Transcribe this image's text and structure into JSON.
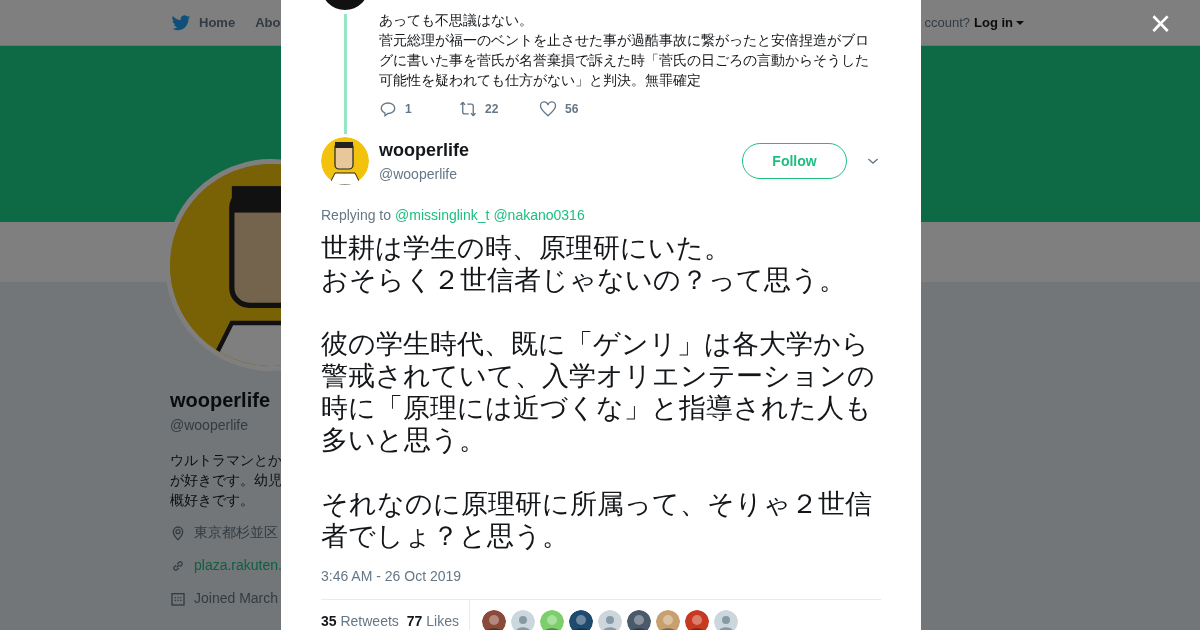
{
  "nav": {
    "items": [
      {
        "label": "Home"
      },
      {
        "label": "Abo"
      }
    ],
    "account_prompt": "ccount?",
    "login": "Log in"
  },
  "profile": {
    "name": "wooperlife",
    "handle": "@wooperlife",
    "bio_lines": [
      "ウルトラマンとか",
      "が好きです。幼児",
      "概好きです。"
    ],
    "location": "東京都杉並区",
    "url": "plaza.rakuten.",
    "joined": "Joined March"
  },
  "modal": {
    "close": "×",
    "previous_tweet": {
      "lines": [
        "あっても不思議はない。",
        "菅元総理が福一のベントを止させた事が過酷事故に繋がったと安倍捏造がブロ",
        "グに書いた事を菅氏が名誉棄損で訴えた時「菅氏の日ごろの言動からそうした",
        "可能性を疑われても仕方がない」と判決。無罪確定"
      ],
      "actions": [
        {
          "kind": "reply",
          "count": "1"
        },
        {
          "kind": "retweet",
          "count": "22"
        },
        {
          "kind": "like",
          "count": "56"
        }
      ]
    },
    "tweet": {
      "name": "wooperlife",
      "handle": "@wooperlife",
      "follow": "Follow",
      "replying_label": "Replying to",
      "mentions": [
        "@missinglink_t",
        "@nakano0316"
      ],
      "paragraphs": [
        [
          "世耕は学生の時、原理研にいた。",
          "おそらく２世信者じゃないの？って思う。"
        ],
        [
          "彼の学生時代、既に「ゲンリ」は各大学から",
          "警戒されていて、入学オリエンテーションの",
          "時に「原理には近づくな」と指導された人も",
          "多いと思う。"
        ],
        [
          "それなのに原理研に所属って、そりゃ２世信",
          "者でしょ？と思う。"
        ]
      ],
      "timestamp": "3:46 AM - 26 Oct 2019",
      "stats": [
        {
          "count": "35",
          "label": "Retweets"
        },
        {
          "count": "77",
          "label": "Likes"
        }
      ],
      "likers": [
        {
          "kind": "picture",
          "color": "#8a4a3a"
        },
        {
          "kind": "default"
        },
        {
          "kind": "picture",
          "color": "#7ccf6a"
        },
        {
          "kind": "picture",
          "color": "#1e4a6e"
        },
        {
          "kind": "default"
        },
        {
          "kind": "picture",
          "color": "#4a5a6a"
        },
        {
          "kind": "picture",
          "color": "#c8a070"
        },
        {
          "kind": "picture",
          "color": "#c83a20"
        },
        {
          "kind": "default"
        }
      ]
    }
  }
}
